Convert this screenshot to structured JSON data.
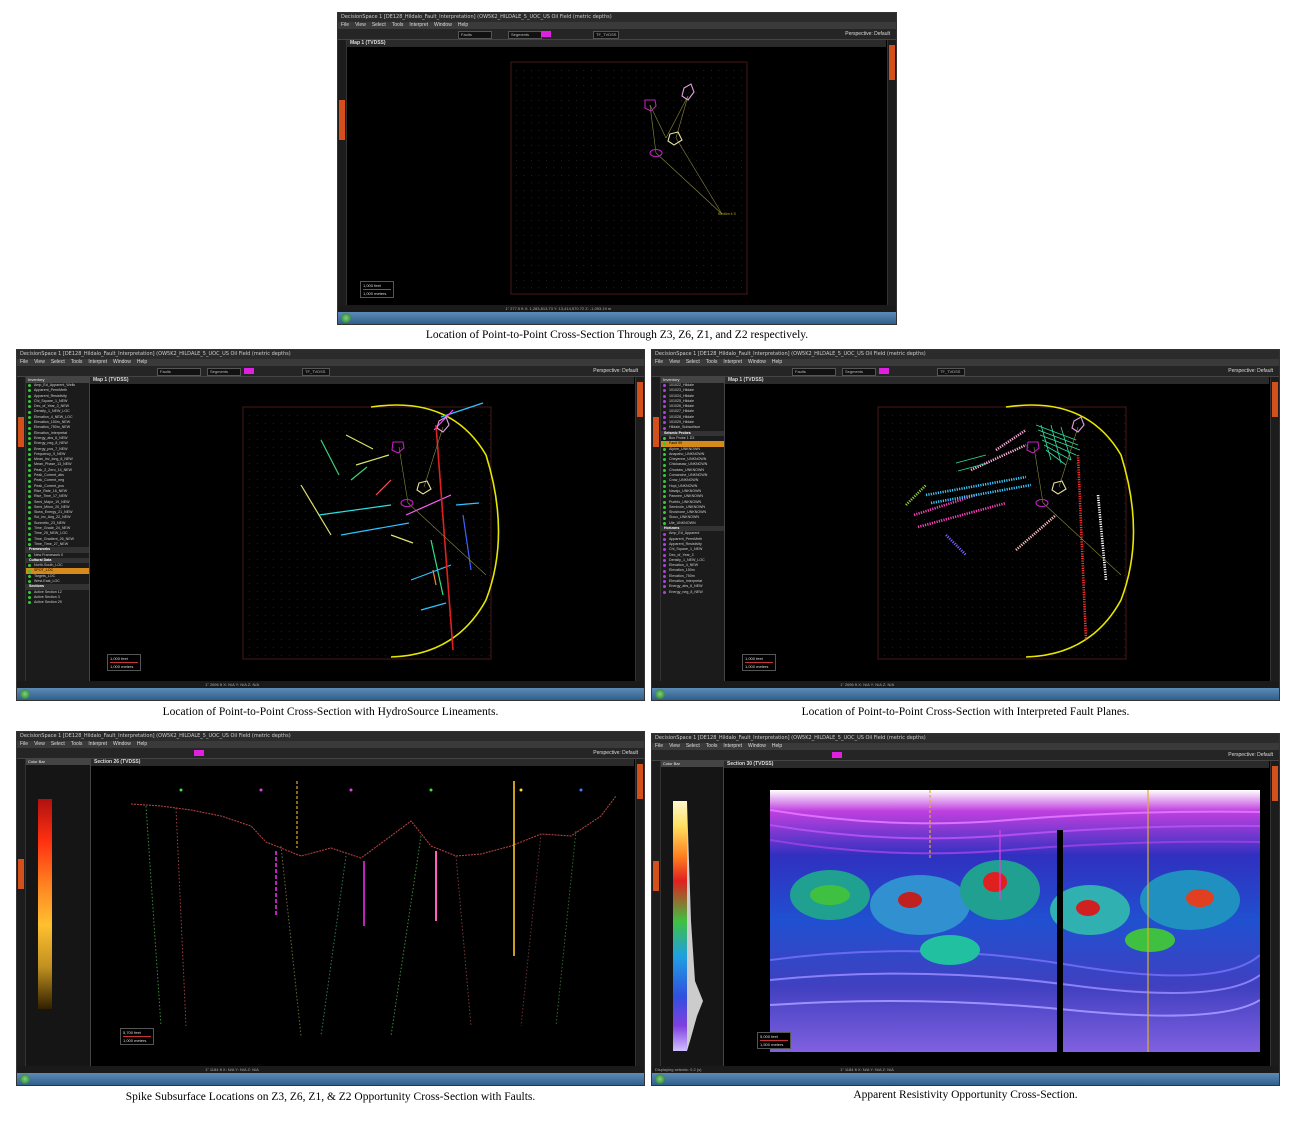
{
  "app_title": "DecisionSpace 1 [DE128_Hildalo_Fault_Interpretation] (OW5K2_HILDALE_5_UOC_US Oil Field (metric depths)",
  "menu_items": [
    "File",
    "View",
    "Select",
    "Tools",
    "Interpret",
    "Window",
    "Help"
  ],
  "perspective_label": "Perspective:",
  "perspective_value": "Default",
  "faults_label": "Faults",
  "segments_label": "Segments",
  "domain_label": "TF_TVDSS",
  "panels": {
    "p1": {
      "view_title": "Map 1 (TVDSS)",
      "scale_top": "1,000 feet",
      "scale_bottom": "1,000 meters",
      "section_label": "Section 4 X",
      "status": "1\" 277.5 ft    X: 1,283,813.73    Y: 13,414,570.72    Z: -1,093.19 m"
    },
    "p2": {
      "view_title": "Map 1 (TVDSS)",
      "scale_top": "1,000 feet",
      "scale_bottom": "1,000 meters",
      "status": "1\" 2696 ft    X: N/A    Y: N/A    Z: N/A"
    },
    "p3": {
      "view_title": "Map 1 (TVDSS)",
      "scale_top": "1,000 feet",
      "scale_bottom": "1,000 meters",
      "status": "1\" 2696 ft    X: N/A    Y: N/A    Z: N/A"
    },
    "p4": {
      "view_title": "Section 26 (TVDSS)",
      "scale_top": "5,700 feet",
      "scale_bottom": "1,000 meters",
      "colorbar_title": "Color Bar",
      "status": "1\" 1184 ft    X: N/A    Y: N/A    Z: N/A"
    },
    "p5": {
      "view_title": "Section 30 (TVDSS)",
      "scale_top": "5,000 feet",
      "scale_bottom": "1,500 meters",
      "colorbar_title": "Color Bar",
      "status": "1\" 1184 ft    X: N/A    Y: N/A    Z: N/A",
      "bottom_left": "Displaying seismic: 0.2 (s)"
    }
  },
  "inventory_p2": {
    "title": "Inventory",
    "rows": [
      "Amp_Ed_Apparent_Wells",
      "Apparent_PermMeth",
      "Apparent_Resistivity",
      "Chi_Square_1_NEW",
      "Dec_of_Year_3_NEW",
      "Density_1_NEW_LOC",
      "Elevation_4_NEW_LOC",
      "Elevation_150m_NEW",
      "Elevation_750m_NEW",
      "Elevation_Interpretat",
      "Energy_abs_6_NEW",
      "Energy_neg_8_NEW",
      "Energy_pos_7_NEW",
      "Frequency_9_NEW",
      "Mean_inv_long_8_NEW",
      "Mean_Phase_13_NEW",
      "Peak_2_Zero_14_NEW",
      "Peak_Current_abs",
      "Peak_Current_neg",
      "Peak_Current_pos",
      "Rise_Rate_16_NEW",
      "Rise_Time_17_NEW",
      "Semi_Major_19_NEW",
      "Semi_Minor_20_NEW",
      "Skew_Energy_21_NEW",
      "Sol_inv_Ang_22_NEW",
      "Sunmetic_23_NEW",
      "Time_Grade_24_NEW",
      "Time_25_NEW_LOC",
      "Time_Gradient_26_NEW",
      "Time_Time_27_NEW"
    ],
    "section_frameworks": "Frameworks",
    "framework_row": "New Framework 0",
    "section_cultural": "Cultural Data",
    "cultural_rows": [
      "North-South_LOC",
      "SPOT_LOC",
      "Targets_LOC",
      "West-East_LOC"
    ],
    "section_sections": "Sections",
    "section_rows": [
      "Active Section 12",
      "Active Section 3",
      "Active Section 29"
    ]
  },
  "inventory_p3": {
    "title": "Inventory",
    "top_rows": [
      "101022_Hildale",
      "101023_Hildale",
      "101024_Hildale",
      "101025_Hildale",
      "101026_Hildale",
      "101027_Hildale",
      "101028_Hildale",
      "101029_Hildale",
      "Hildale_Subsurface"
    ],
    "section_seismic": "Seismic Probes",
    "seismic_rows": [
      "Box Probe 1 D3",
      "Fault 99"
    ],
    "fault_rows": [
      "Alpine_UNKNOWN",
      "Anapaho_UNKNOWN",
      "Cheyenne_UNKNOWN",
      "Chickasaw_UNKNOWN",
      "Choctaw_UNKNOWN",
      "Comanche_UNKNOWN",
      "Crow_UNKNOWN",
      "Hopi_UNKNOWN",
      "Navajo_UNKNOWN",
      "Pawnee_UNKNOWN",
      "Pueblo_UNKNOWN",
      "Seminole_UNKNOWN",
      "Shoshone_UNKNOWN",
      "Sioux_UNKNOWN",
      "Ute_UNKNOWN"
    ],
    "section_horizons": "Horizons",
    "horizon_rows": [
      "Amp_Ed_Apparent",
      "Apparent_PermMeth",
      "Apparent_Resistivity",
      "Chi_Square_1_NEW",
      "Dec_of_Year_3",
      "Density_1_NEW_LOC",
      "Elevation_4_NEW",
      "Elevation_150m",
      "Elevation_750m",
      "Elevation_Interpretat",
      "Energy_abs_6_NEW",
      "Energy_neg_8_NEW"
    ]
  },
  "captions": {
    "c1": "Location of Point-to-Point Cross-Section Through Z3, Z6, Z1, and Z2 respectively.",
    "c2": "Location of Point-to-Point Cross-Section with HydroSource Lineaments.",
    "c3": "Location of Point-to-Point Cross-Section with Interpreted Fault Planes.",
    "c4": "Spike Subsurface Locations on Z3, Z6, Z1, & Z2 Opportunity Cross-Section with Faults.",
    "c5": "Apparent Resistivity Opportunity Cross-Section."
  },
  "clock": "3:23 PM",
  "colors": {
    "accent_orange": "#d4501a",
    "fault_yellow": "#e8e000",
    "marker_pink": "#d040d0",
    "survey_red": "#b03030"
  }
}
